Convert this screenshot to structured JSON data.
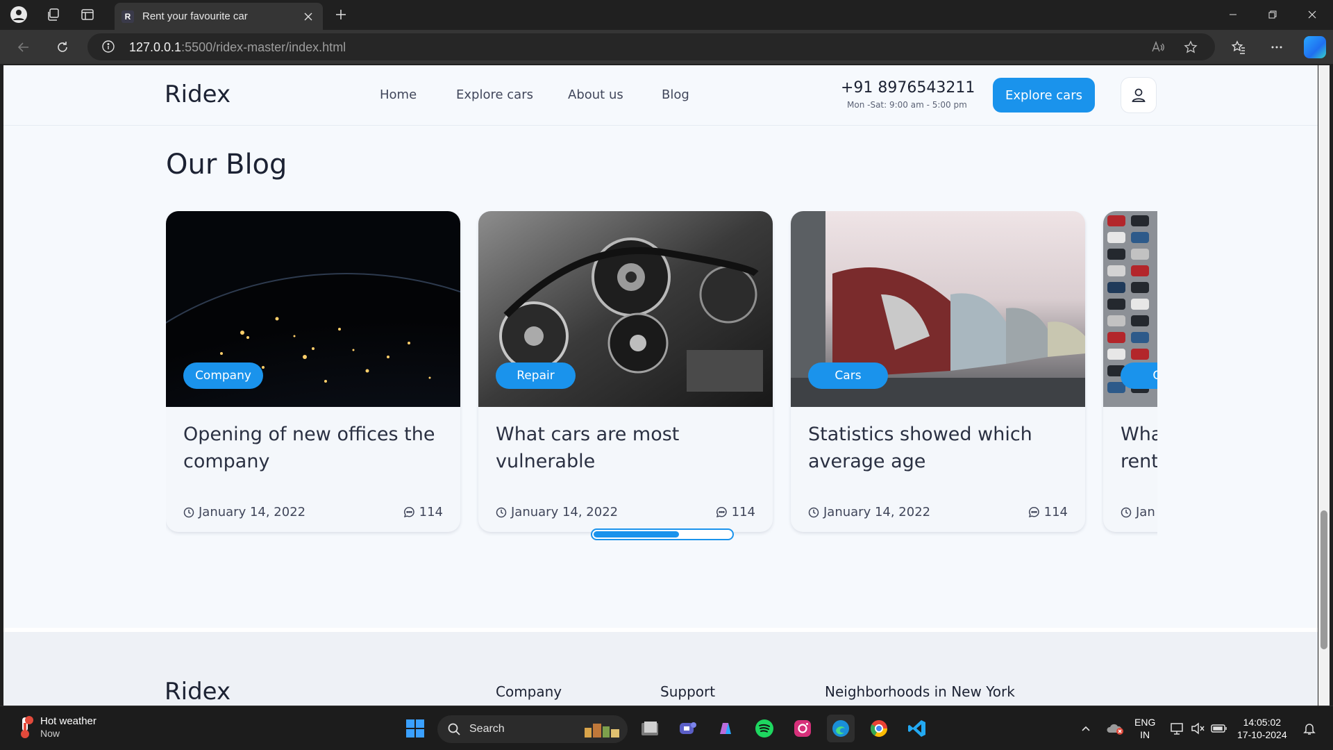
{
  "browser": {
    "tab_favicon": "R",
    "tab_title": "Rent your favourite car",
    "url_host": "127.0.0.1",
    "url_path": ":5500/ridex-master/index.html"
  },
  "site": {
    "logo": "Ridex",
    "nav": [
      "Home",
      "Explore cars",
      "About us",
      "Blog"
    ],
    "phone": "+91 8976543211",
    "hours": "Mon -Sat: 9:00 am - 5:00 pm",
    "cta_label": "Explore cars"
  },
  "blog": {
    "title": "Our Blog",
    "cards": [
      {
        "badge": "Company",
        "title": "Opening of new offices the company",
        "date": "January 14, 2022",
        "comments": "114",
        "image": "earth-night"
      },
      {
        "badge": "Repair",
        "title": "What cars are most vulnerable",
        "date": "January 14, 2022",
        "comments": "114",
        "image": "engine"
      },
      {
        "badge": "Cars",
        "title": "Statistics showed which average age",
        "date": "January 14, 2022",
        "comments": "114",
        "image": "vintage-cars"
      },
      {
        "badge": "Co",
        "title": "Wha rent",
        "date": "Jan",
        "comments": "",
        "image": "parking-lot"
      }
    ],
    "slider_progress": 0.62
  },
  "footer": {
    "logo": "Ridex",
    "columns": [
      "Company",
      "Support",
      "Neighborhoods in New York"
    ]
  },
  "taskbar": {
    "weather_title": "Hot weather",
    "weather_sub": "Now",
    "search_label": "Search",
    "lang_top": "ENG",
    "lang_bottom": "IN",
    "time": "14:05:02",
    "date": "17-10-2024",
    "apps": [
      "windows-start-icon",
      "file-explorer-icon",
      "teams-icon",
      "copilot-icon",
      "spotify-icon",
      "instagram-icon",
      "edge-icon",
      "chrome-icon",
      "vscode-icon"
    ]
  },
  "colors": {
    "accent": "#1a93ec",
    "page_bg": "#f6f9fd",
    "text_dark": "#1c2233"
  }
}
